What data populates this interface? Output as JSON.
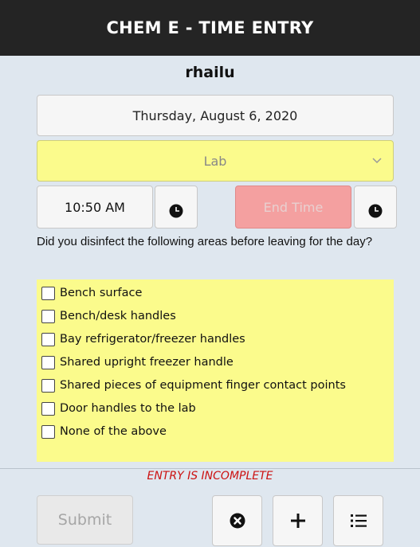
{
  "header": {
    "title": "CHEM E - TIME ENTRY"
  },
  "user": {
    "name": "rhailu"
  },
  "date": {
    "value": "Thursday, August 6, 2020"
  },
  "category": {
    "selected": "Lab"
  },
  "time": {
    "start": "10:50 AM",
    "end_placeholder": "End Time"
  },
  "question": {
    "text": "Did you disinfect the following areas before leaving for the day?"
  },
  "checklist": {
    "items": [
      {
        "label": "Bench surface",
        "checked": false
      },
      {
        "label": "Bench/desk handles",
        "checked": false
      },
      {
        "label": "Bay refrigerator/freezer handles",
        "checked": false
      },
      {
        "label": "Shared upright freezer handle",
        "checked": false
      },
      {
        "label": "Shared pieces of equipment finger contact points",
        "checked": false
      },
      {
        "label": "Door handles to the lab",
        "checked": false
      },
      {
        "label": "None of the above",
        "checked": false
      }
    ]
  },
  "status": {
    "text": "ENTRY IS INCOMPLETE",
    "color": "#cc1111"
  },
  "footer": {
    "submit_label": "Submit",
    "icons": [
      "clear-icon",
      "plus-icon",
      "list-icon"
    ]
  },
  "colors": {
    "header_bg": "#242424",
    "highlight_yellow": "#fbfb8c",
    "end_time_bg": "#f4a0a0",
    "page_bg": "#dfe7ef"
  }
}
